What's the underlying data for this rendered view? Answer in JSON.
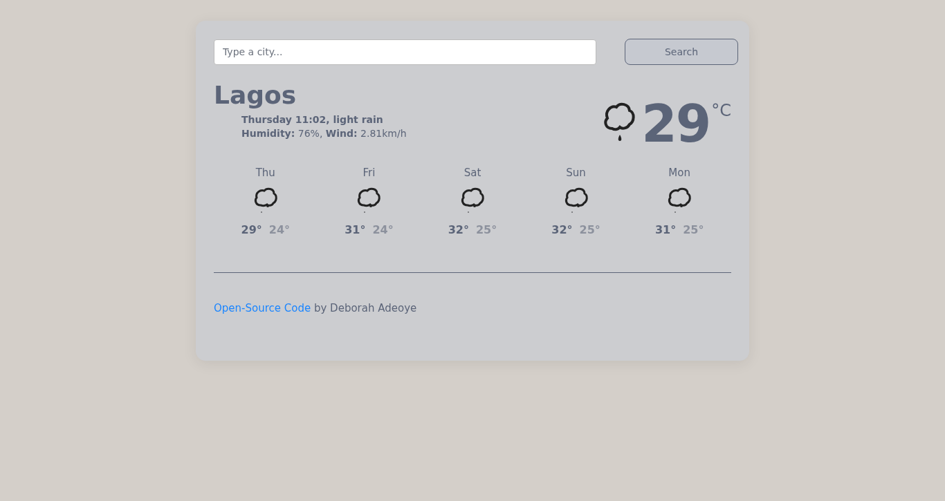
{
  "search": {
    "placeholder": "Type a city...",
    "button": "Search"
  },
  "current": {
    "city": "Lagos",
    "description": "Thursday 11:02, light rain",
    "details": "**Humidity:** 76%, **Wind:** 2.81km/h",
    "temperature": "29",
    "unit": "°C"
  },
  "forecast": [
    {
      "day": "Thu",
      "max": "29°",
      "min": "24°"
    },
    {
      "day": "Fri",
      "max": "31°",
      "min": "24°"
    },
    {
      "day": "Sat",
      "max": "32°",
      "min": "25°"
    },
    {
      "day": "Sun",
      "max": "32°",
      "min": "25°"
    },
    {
      "day": "Mon",
      "max": "31°",
      "min": "25°"
    }
  ],
  "footer": {
    "link": "Open-Source Code",
    "text": " by Deborah Adeoye"
  }
}
